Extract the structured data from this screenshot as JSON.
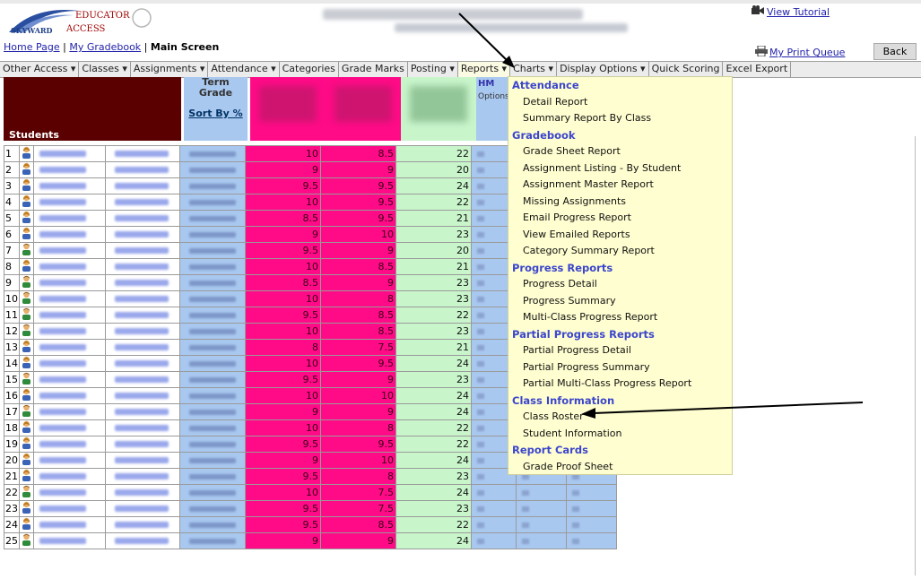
{
  "header": {
    "tutorial_label": "View Tutorial",
    "print_queue_label": "My Print Queue",
    "back_label": "Back"
  },
  "logo": {
    "line1": "EDUCATOR",
    "line2": "ACCESS",
    "brand": "SKYWARD"
  },
  "breadcrumb": {
    "home": "Home Page",
    "sep": " | ",
    "gradebook": "My Gradebook",
    "current": "Main Screen"
  },
  "menubar": {
    "items": [
      "Other Access ▾",
      "Classes ▾",
      "Assignments ▾",
      "Attendance ▾",
      "Categories",
      "Grade Marks",
      "Posting ▾",
      "Reports ▾",
      "Charts ▾",
      "Display Options ▾",
      "Quick Scoring",
      "Excel Export"
    ]
  },
  "table": {
    "students_header": "Students",
    "term_header": "Term Grade",
    "sort_label": "Sort By %",
    "hm_label": "HM",
    "options_label": "Options",
    "rows": [
      {
        "n": "1",
        "a": "10",
        "b": "8.5",
        "c": "22"
      },
      {
        "n": "2",
        "a": "9",
        "b": "9",
        "c": "20"
      },
      {
        "n": "3",
        "a": "9.5",
        "b": "9.5",
        "c": "24"
      },
      {
        "n": "4",
        "a": "10",
        "b": "9.5",
        "c": "22"
      },
      {
        "n": "5",
        "a": "8.5",
        "b": "9.5",
        "c": "21"
      },
      {
        "n": "6",
        "a": "9",
        "b": "10",
        "c": "23"
      },
      {
        "n": "7",
        "a": "9.5",
        "b": "9",
        "c": "20"
      },
      {
        "n": "8",
        "a": "10",
        "b": "8.5",
        "c": "21"
      },
      {
        "n": "9",
        "a": "8.5",
        "b": "9",
        "c": "23"
      },
      {
        "n": "10",
        "a": "10",
        "b": "8",
        "c": "23"
      },
      {
        "n": "11",
        "a": "9.5",
        "b": "8.5",
        "c": "22"
      },
      {
        "n": "12",
        "a": "10",
        "b": "8.5",
        "c": "23"
      },
      {
        "n": "13",
        "a": "8",
        "b": "7.5",
        "c": "21"
      },
      {
        "n": "14",
        "a": "10",
        "b": "9.5",
        "c": "24"
      },
      {
        "n": "15",
        "a": "9.5",
        "b": "9",
        "c": "23"
      },
      {
        "n": "16",
        "a": "10",
        "b": "10",
        "c": "24"
      },
      {
        "n": "17",
        "a": "9",
        "b": "9",
        "c": "24"
      },
      {
        "n": "18",
        "a": "10",
        "b": "8",
        "c": "22"
      },
      {
        "n": "19",
        "a": "9.5",
        "b": "9.5",
        "c": "22"
      },
      {
        "n": "20",
        "a": "9",
        "b": "10",
        "c": "24"
      },
      {
        "n": "21",
        "a": "9.5",
        "b": "8",
        "c": "23"
      },
      {
        "n": "22",
        "a": "10",
        "b": "7.5",
        "c": "24"
      },
      {
        "n": "23",
        "a": "9.5",
        "b": "7.5",
        "c": "23"
      },
      {
        "n": "24",
        "a": "9.5",
        "b": "8.5",
        "c": "22"
      },
      {
        "n": "25",
        "a": "9",
        "b": "9",
        "c": "24"
      }
    ]
  },
  "reports_menu": {
    "groups": [
      {
        "title": "Attendance",
        "items": [
          "Detail Report",
          "Summary Report By Class"
        ]
      },
      {
        "title": "Gradebook",
        "items": [
          "Grade Sheet Report",
          "Assignment Listing - By Student",
          "Assignment Master Report",
          "Missing Assignments",
          "Email Progress Report",
          "View Emailed Reports",
          "Category Summary Report"
        ]
      },
      {
        "title": "Progress Reports",
        "items": [
          "Progress Detail",
          "Progress Summary",
          "Multi-Class Progress Report"
        ]
      },
      {
        "title": "Partial Progress Reports",
        "items": [
          "Partial Progress Detail",
          "Partial Progress Summary",
          "Partial Multi-Class Progress Report"
        ]
      },
      {
        "title": "Class Information",
        "items": [
          "Class Roster",
          "Student Information"
        ]
      },
      {
        "title": "Report Cards",
        "items": [
          "Grade Proof Sheet"
        ]
      }
    ]
  },
  "colors": {
    "students_header_bg": "#5a0000",
    "term_col": "#a9c8ef",
    "pink_col": "#ff0a87",
    "green_col": "#c9f5cb",
    "dropdown_bg": "#fffed0",
    "category_text": "#3b46cc"
  },
  "icons": [
    "student-girl-icon",
    "student-boy-icon",
    "video-camera-icon",
    "printer-icon",
    "annotation-arrow"
  ]
}
